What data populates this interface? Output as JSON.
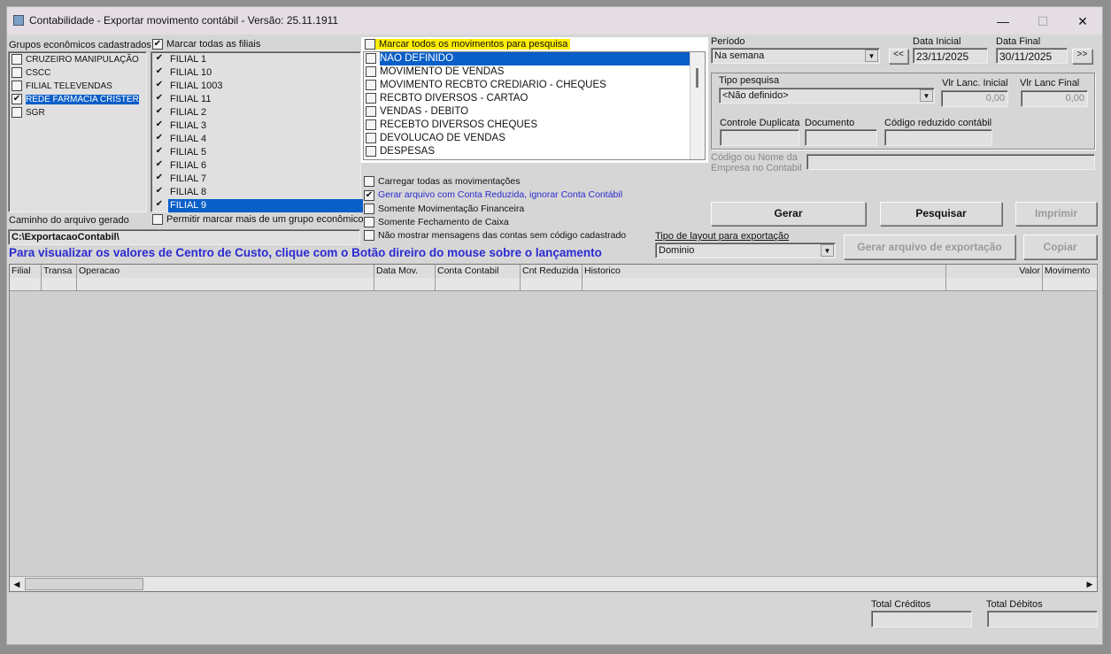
{
  "window": {
    "title": "Contabilidade - Exportar movimento contábil - Versão: 25.11.1911",
    "minimize": "—",
    "maximize": "☐",
    "close": "✕"
  },
  "groups": {
    "label": "Grupos econômicos cadastrados",
    "items": [
      {
        "label": "CRUZEIRO MANIPULAÇÃO",
        "checked": false
      },
      {
        "label": "CSCC",
        "checked": false
      },
      {
        "label": "FILIAL TELEVENDAS",
        "checked": false
      },
      {
        "label": "REDE FARMACIA CRISTER",
        "checked": true,
        "selected": true
      },
      {
        "label": "SGR",
        "checked": false
      }
    ]
  },
  "filiais": {
    "mark_all_label": "Marcar todas as filiais",
    "items": [
      "FILIAL 1",
      "FILIAL 10",
      "FILIAL 1003",
      "FILIAL 11",
      "FILIAL 2",
      "FILIAL 3",
      "FILIAL 4",
      "FILIAL 5",
      "FILIAL 6",
      "FILIAL 7",
      "FILIAL 8",
      "FILIAL 9"
    ]
  },
  "path": {
    "label": "Caminho do arquivo gerado",
    "value": "C:\\ExportacaoContabil\\"
  },
  "allow_multi_label": "Permitir marcar mais de um grupo econômico",
  "info_text": "Para visualizar os valores de Centro de Custo, clique com o Botão direiro do mouse sobre o lançamento",
  "movements": {
    "mark_all_label": "Marcar todos os movimentos para pesquisa",
    "items": [
      "NAO DEFINIDO",
      "MOVIMENTO DE VENDAS",
      "MOVIMENTO RECBTO CREDIARIO - CHEQUES",
      "RECBTO DIVERSOS - CARTAO",
      "VENDAS - DEBITO",
      "RECEBTO DIVERSOS CHEQUES",
      "DEVOLUCAO DE VENDAS",
      "DESPESAS"
    ]
  },
  "options": [
    {
      "label": "Carregar todas as movimentações",
      "checked": false
    },
    {
      "label": "Gerar arquivo com Conta Reduzida, ignorar Conta Contábil",
      "checked": true
    },
    {
      "label": "Somente Movimentação Financeira",
      "checked": false
    },
    {
      "label": "Somente Fechamento de Caixa",
      "checked": false
    },
    {
      "label": "Não mostrar mensagens das contas sem código cadastrado",
      "checked": false
    }
  ],
  "periodo": {
    "label": "Período",
    "value": "Na semana",
    "prev": "<<",
    "next": ">>"
  },
  "data_inicial": {
    "label": "Data Inicial",
    "value": "23/11/2025"
  },
  "data_final": {
    "label": "Data Final",
    "value": "30/11/2025"
  },
  "tipo_pesquisa": {
    "label": "Tipo pesquisa",
    "value": "<Não definido>"
  },
  "vlr_inicial": {
    "label": "Vlr Lanc. Inicial",
    "value": "0,00"
  },
  "vlr_final": {
    "label": "Vlr Lanc Final",
    "value": "0,00"
  },
  "controle_duplicata": {
    "label": "Controle Duplicata",
    "value": ""
  },
  "documento": {
    "label": "Documento",
    "value": ""
  },
  "codigo_reduzido": {
    "label": "Código reduzido contábil",
    "value": ""
  },
  "empresa": {
    "label": "Código ou Nome da Empresa no Contabil",
    "value": ""
  },
  "buttons": {
    "gerar": "Gerar",
    "pesquisar": "Pesquisar",
    "imprimir": "Imprimir",
    "gerar_arquivo": "Gerar arquivo de exportação",
    "copiar": "Copiar"
  },
  "layout": {
    "label": "Tipo de layout para exportação",
    "value": "Dominio"
  },
  "grid": {
    "columns": [
      "Filial",
      "Transa",
      "Operacao",
      "Data Mov.",
      "Conta Contabil",
      "Cnt Reduzida",
      "Historico",
      "Valor",
      "Movimento"
    ]
  },
  "totals": {
    "creditos_label": "Total Créditos",
    "creditos": "",
    "debitos_label": "Total Débitos",
    "debitos": ""
  }
}
